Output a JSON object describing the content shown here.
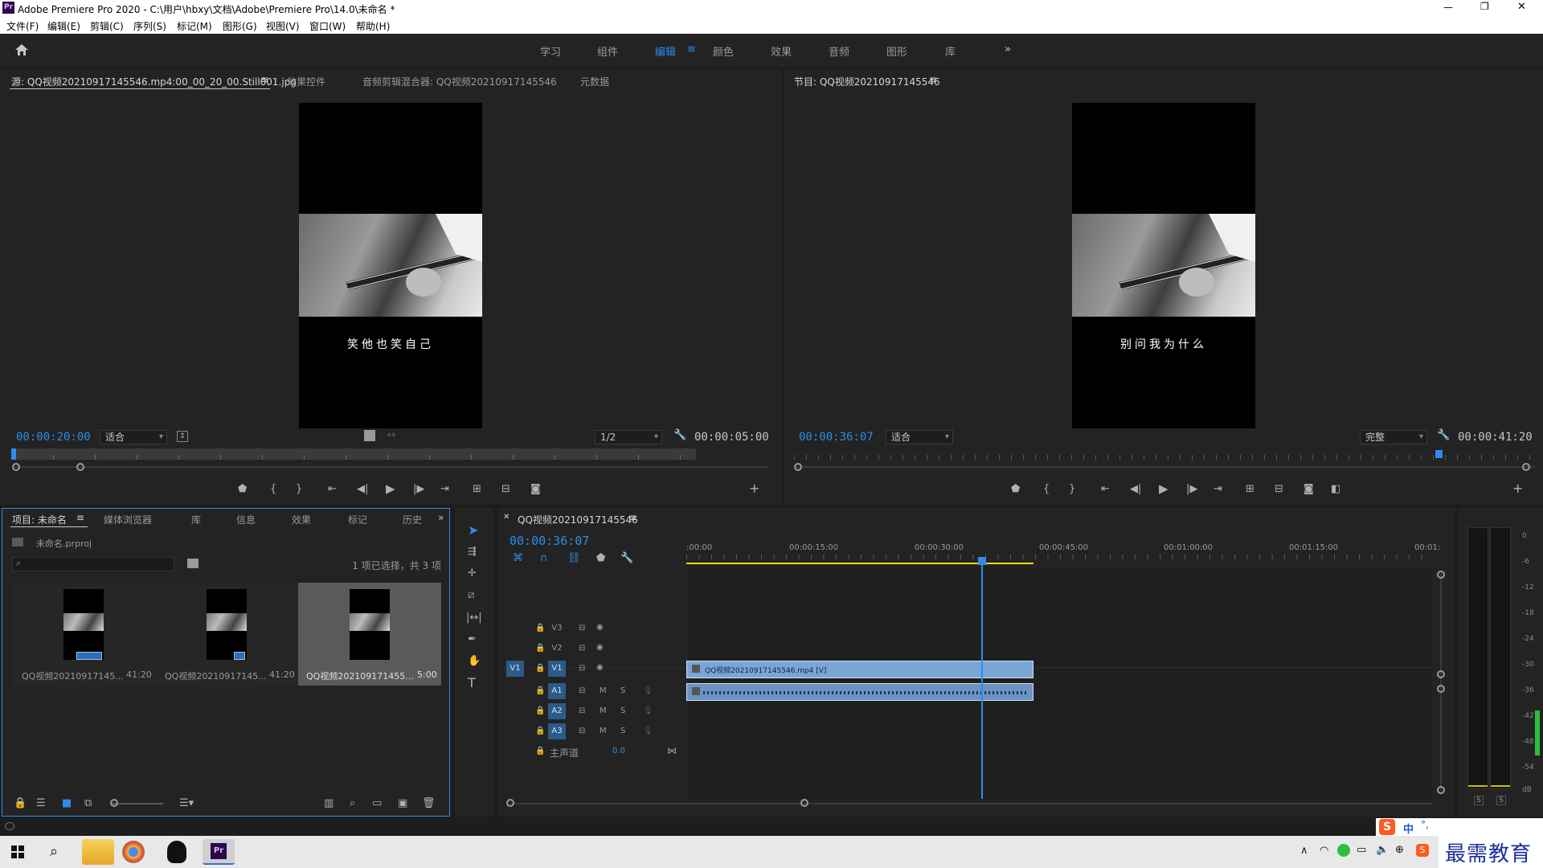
{
  "window": {
    "title": "Adobe Premiere Pro 2020 - C:\\用户\\hbxy\\文档\\Adobe\\Premiere Pro\\14.0\\未命名 *",
    "logo": "Pr",
    "controls": [
      "—",
      "❐",
      "✕"
    ]
  },
  "menu": [
    "文件(F)",
    "编辑(E)",
    "剪辑(C)",
    "序列(S)",
    "标记(M)",
    "图形(G)",
    "视图(V)",
    "窗口(W)",
    "帮助(H)"
  ],
  "workspaces": {
    "items": [
      "学习",
      "组件",
      "编辑",
      "颜色",
      "效果",
      "音频",
      "图形",
      "库"
    ],
    "active": "编辑",
    "more": "»"
  },
  "source": {
    "tabs": [
      "源: QQ视频20210917145546.mp4:00_00_20_00.Still001.jpg",
      "效果控件",
      "音频剪辑混合器: QQ视频20210917145546",
      "元数据"
    ],
    "subtitle": "笑他也笑自己",
    "timecode": "00:00:20:00",
    "fit": "适合",
    "resolution": "1/2",
    "duration": "00:00:05:00"
  },
  "program": {
    "tab": "节目: QQ视频20210917145546",
    "subtitle": "别问我为什么",
    "timecode": "00:00:36:07",
    "fit": "适合",
    "quality": "完整",
    "duration": "00:00:41:20"
  },
  "project": {
    "tabs": [
      "项目: 未命名",
      "媒体浏览器",
      "库",
      "信息",
      "效果",
      "标记",
      "历史"
    ],
    "file": "未命名.prproj",
    "search_placeholder": "",
    "selection": "1 项已选择，共 3 项",
    "items": [
      {
        "name": "QQ视频20210917145...",
        "duration": "41:20"
      },
      {
        "name": "QQ视频20210917145...",
        "duration": "41:20"
      },
      {
        "name": "QQ视频202109171455...",
        "duration": "5:00"
      }
    ]
  },
  "timeline": {
    "tab": "QQ视频20210917145546",
    "timecode": "00:00:36:07",
    "ruler": [
      ":00:00",
      "00:00:15:00",
      "00:00:30:00",
      "00:00:45:00",
      "00:01:00:00",
      "00:01:15:00",
      "00:01:"
    ],
    "video_tracks": [
      "V3",
      "V2",
      "V1"
    ],
    "audio_tracks": [
      "A1",
      "A2",
      "A3"
    ],
    "source_patch_v": "V1",
    "master": {
      "label": "主声道",
      "value": "0.0"
    },
    "clip_video": "QQ视频20210917145546.mp4 [V]",
    "mute": "M",
    "solo": "S",
    "playhead_fraction": 0.395
  },
  "meter": {
    "scale": [
      "0",
      "-6",
      "-12",
      "-18",
      "-24",
      "-30",
      "-36",
      "-42",
      "-48",
      "-54",
      "dB"
    ],
    "solo": [
      "S",
      "S"
    ]
  },
  "ime": {
    "label": "中",
    "punct": "°,"
  },
  "watermark": "最需教育",
  "colors": {
    "accent": "#2d8ceb",
    "clip_video": "#7aa6d6",
    "clip_audio": "#6c93c2",
    "panel": "#232323",
    "bg": "#1d1d1d",
    "meter_green": "#2fbf3f",
    "inout_yellow": "#e8e000"
  }
}
